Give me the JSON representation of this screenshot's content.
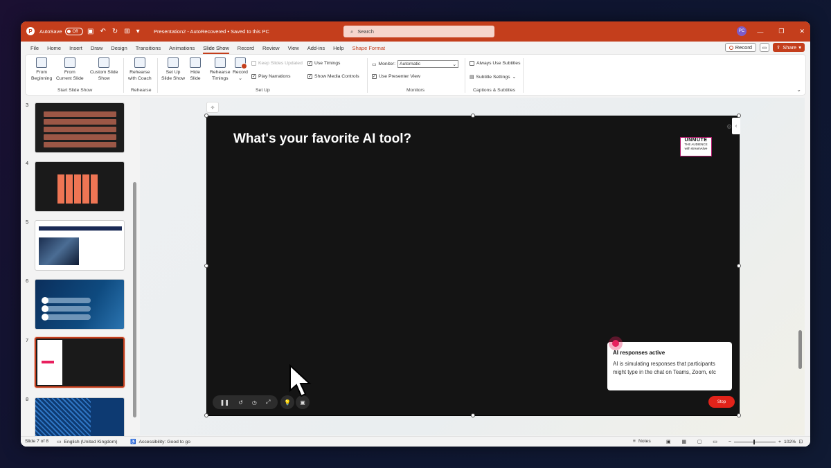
{
  "titlebar": {
    "autosave_label": "AutoSave",
    "autosave_state": "Off",
    "doc_title": "Presentation2  -  AutoRecovered  •  Saved to this PC",
    "search_placeholder": "Search",
    "avatar_initials": "PC"
  },
  "menu": {
    "items": [
      "File",
      "Home",
      "Insert",
      "Draw",
      "Design",
      "Transitions",
      "Animations",
      "Slide Show",
      "Record",
      "Review",
      "View",
      "Add-ins",
      "Help",
      "Shape Format"
    ],
    "active": "Slide Show",
    "record_label": "Record",
    "share_label": "Share"
  },
  "ribbon": {
    "from_beginning": [
      "From",
      "Beginning"
    ],
    "from_current": [
      "From",
      "Current Slide"
    ],
    "custom_show": [
      "Custom Slide",
      "Show"
    ],
    "rehearse_coach": [
      "Rehearse",
      "with Coach"
    ],
    "setup_show": [
      "Set Up",
      "Slide Show"
    ],
    "hide_slide": [
      "Hide",
      "Slide"
    ],
    "rehearse_timings": [
      "Rehearse",
      "Timings"
    ],
    "record": "Record",
    "keep_slides_updated": "Keep Slides Updated",
    "play_narrations": "Play Narrations",
    "use_timings": "Use Timings",
    "show_media_controls": "Show Media Controls",
    "monitor_label": "Monitor:",
    "monitor_value": "Automatic",
    "use_presenter_view": "Use Presenter View",
    "always_use_subtitles": "Always Use Subtitles",
    "subtitle_settings": "Subtitle Settings",
    "groups": {
      "start": "Start Slide Show",
      "rehearse": "Rehearse",
      "setup": "Set Up",
      "monitors": "Monitors",
      "captions": "Captions & Subtitles"
    }
  },
  "thumbnails": {
    "numbers": [
      "3",
      "4",
      "5",
      "6",
      "7",
      "8"
    ],
    "selected": "7"
  },
  "slide": {
    "title": "What's your favorite AI tool?",
    "logo_line1": "UNMUTE",
    "logo_line2": "THE AUDIENCE",
    "logo_line3": "with streamAlive",
    "popup_title": "AI responses active",
    "popup_body": "AI is simulating responses that participants might type in the chat on Teams, Zoom, etc",
    "stop_label": "Stop"
  },
  "status": {
    "slide_counter": "Slide 7 of 8",
    "language": "English (United Kingdom)",
    "accessibility": "Accessibility: Good to go",
    "notes": "Notes",
    "zoom": "102%"
  },
  "colors": {
    "accent": "#c43e1c",
    "slide_bg": "#141414",
    "stop": "#e2231a"
  }
}
